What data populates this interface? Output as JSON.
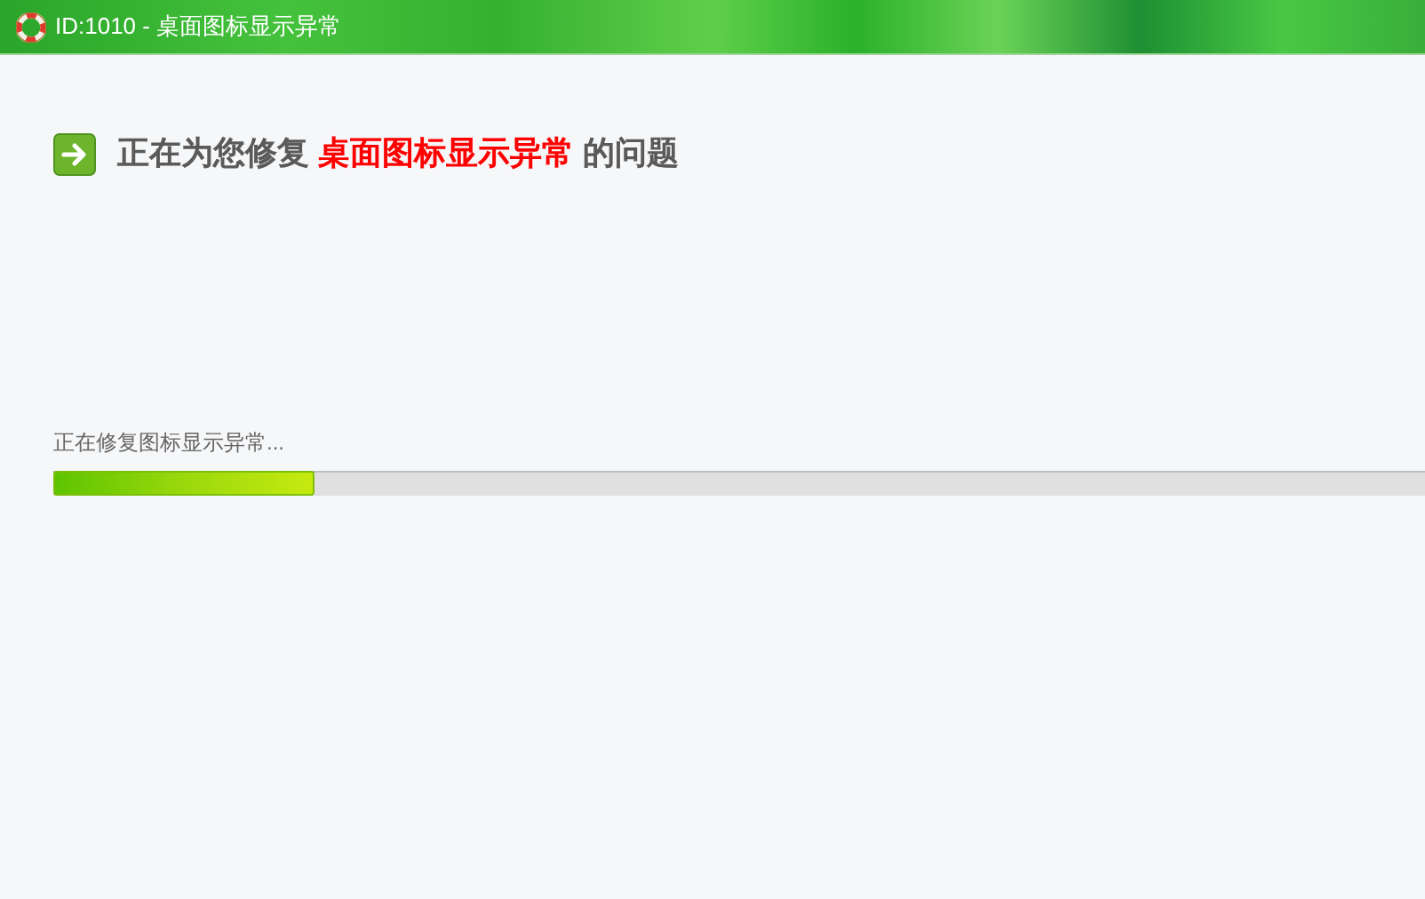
{
  "window": {
    "title": "ID:1010 - 桌面图标显示异常"
  },
  "heading": {
    "prefix": "正在为您修复",
    "highlight": "桌面图标显示异常",
    "suffix": "的问题"
  },
  "progress": {
    "status": "正在修复图标显示异常...",
    "level": 0.19
  }
}
